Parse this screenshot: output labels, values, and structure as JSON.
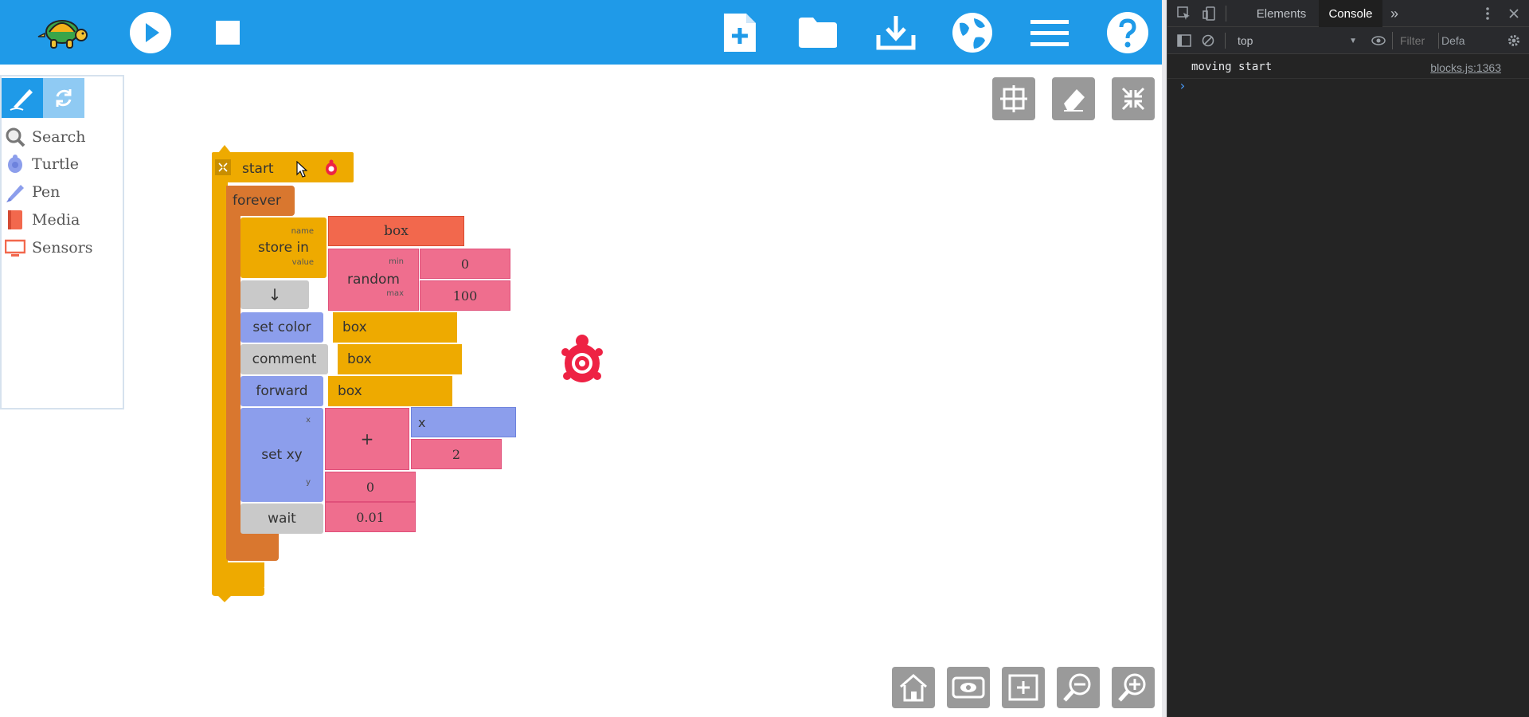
{
  "toolbar": {
    "icons": [
      "turtle-logo",
      "run-icon",
      "stop-icon",
      "new-file-icon",
      "open-folder-icon",
      "download-icon",
      "globe-icon",
      "menu-icon",
      "help-icon"
    ]
  },
  "palette": {
    "tabs": [
      "pen-tab-icon",
      "refresh-tab-icon"
    ],
    "items": [
      {
        "label": "Search",
        "icon": "search-icon"
      },
      {
        "label": "Turtle",
        "icon": "turtle-icon"
      },
      {
        "label": "Pen",
        "icon": "pen-icon"
      },
      {
        "label": "Media",
        "icon": "media-icon"
      },
      {
        "label": "Sensors",
        "icon": "sensors-icon"
      }
    ]
  },
  "blocks": {
    "start": "start",
    "forever": "forever",
    "store_in": "store in",
    "name_port": "name",
    "value_port": "value",
    "box_name": "box",
    "random": "random",
    "min_port": "min",
    "max_port": "max",
    "min_value": "0",
    "max_value": "100",
    "arrow": "↓",
    "set_color": "set color",
    "set_color_arg": "box",
    "comment": "comment",
    "comment_arg": "box",
    "forward": "forward",
    "forward_arg": "box",
    "set_xy": "set xy",
    "x_port": "x",
    "y_port": "y",
    "plus": "+",
    "x_var": "x",
    "two": "2",
    "y_value": "0",
    "wait": "wait",
    "wait_value": "0.01"
  },
  "colors": {
    "topbar": "#1f9ae8",
    "start_block": "#eeaa00",
    "forever_block": "#d9772f",
    "turtle_block": "#8c9eec",
    "number_block": "#ef6e8e",
    "name_block": "#f2684d",
    "turtle_sprite": "#ee2244"
  },
  "devtools": {
    "tabs": [
      "Elements",
      "Console"
    ],
    "active_tab": "Console",
    "more_tabs": "»",
    "context": "top",
    "filter_placeholder": "Filter",
    "levels": "Defa",
    "log_message": "moving start",
    "log_source": "blocks.js:1363",
    "prompt": "›"
  }
}
